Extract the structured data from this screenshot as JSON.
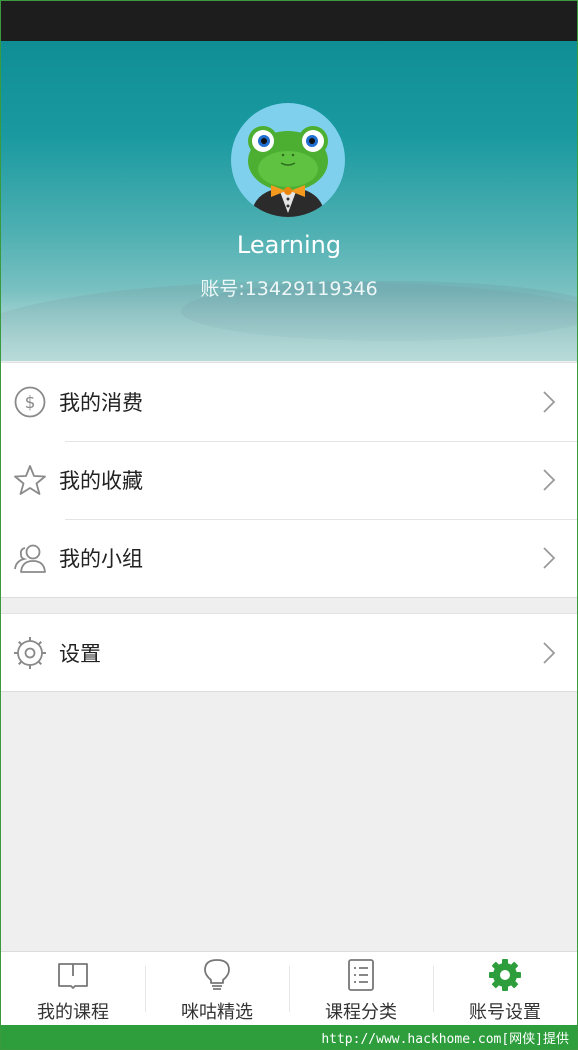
{
  "profile": {
    "username": "Learning",
    "account": "账号:13429119346"
  },
  "menu": {
    "items": [
      {
        "label": "我的消费",
        "icon": "dollar-circle-icon"
      },
      {
        "label": "我的收藏",
        "icon": "star-icon"
      },
      {
        "label": "我的小组",
        "icon": "users-icon"
      }
    ],
    "settings": {
      "label": "设置",
      "icon": "gear-outline-icon"
    }
  },
  "tabs": [
    {
      "label": "我的课程",
      "icon": "book-icon",
      "active": false
    },
    {
      "label": "咪咕精选",
      "icon": "lightbulb-icon",
      "active": false
    },
    {
      "label": "课程分类",
      "icon": "list-icon",
      "active": false
    },
    {
      "label": "账号设置",
      "icon": "gear-icon",
      "active": true
    }
  ],
  "watermark": "http://www.hackhome.com[网侠]提供",
  "colors": {
    "accent": "#2e9e3d",
    "icon_gray": "#8a8a8a"
  }
}
